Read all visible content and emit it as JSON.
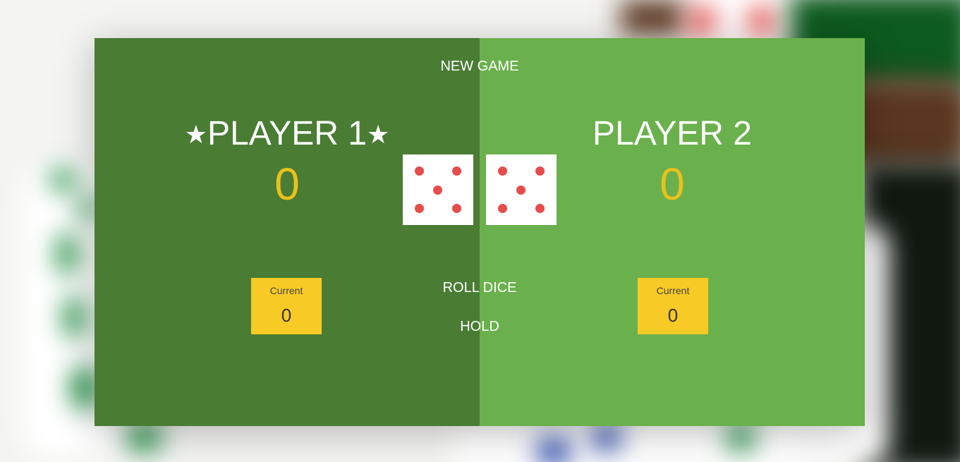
{
  "game": {
    "new_game_label": "NEW GAME",
    "roll_dice_label": "ROLL DICE",
    "hold_label": "HOLD",
    "active_player": 1
  },
  "players": [
    {
      "name": "PLAYER 1",
      "active_marker": "★",
      "score": "0",
      "current_label": "Current",
      "current_score": "0"
    },
    {
      "name": "PLAYER 2",
      "score": "0",
      "current_label": "Current",
      "current_score": "0"
    }
  ],
  "dice": [
    {
      "value": 5
    },
    {
      "value": 5
    }
  ],
  "colors": {
    "active_panel": "#4a7c34",
    "inactive_panel": "#6ab04c",
    "score": "#e8c21c",
    "current_box": "#f8ca26",
    "pip": "#e74c4c"
  }
}
